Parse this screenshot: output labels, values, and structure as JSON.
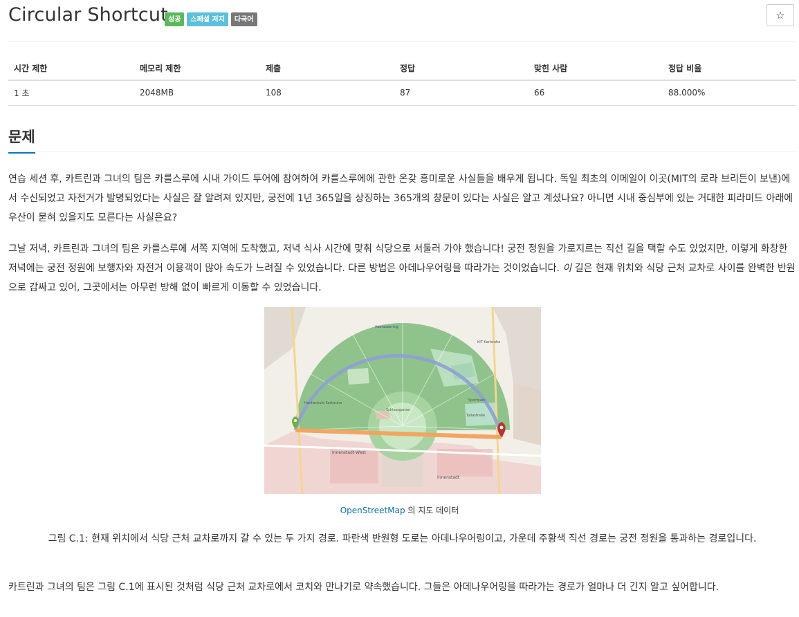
{
  "problem": {
    "title": "Circular Shortcut",
    "badges": [
      "성공",
      "스페셜 저지",
      "다국어"
    ]
  },
  "stats": {
    "headers": [
      "시간 제한",
      "메모리 제한",
      "제출",
      "정답",
      "맞힌 사람",
      "정답 비율"
    ],
    "values": [
      "1 초",
      "2048MB",
      "108",
      "87",
      "66",
      "88.000%"
    ]
  },
  "section": {
    "title": "문제"
  },
  "paragraphs": {
    "p1": "연습 세션 후, 카트린과 그녀의 팀은 카를스루에 시내 가이드 투어에 참여하여 카를스루에에 관한 온갖 흥미로운 사실들을 배우게 됩니다. 독일 최초의 이메일이 이곳(MIT의 로라 브리든이 보낸)에서 수신되었고 자전거가 발명되었다는 사실은 잘 알려져 있지만, 궁전에 1년 365일을 상징하는 365개의 창문이 있다는 사실은 알고 계셨나요? 아니면 시내 중심부에 있는 거대한 피라미드 아래에 우산이 묻혀 있을지도 모른다는 사실은요?",
    "p2_before": "그날 저녁, 카트린과 그녀의 팀은 카를스루에 서쪽 지역에 도착했고, 저녁 식사 시간에 맞춰 식당으로 서둘러 가야 했습니다! 궁전 정원을 가로지르는 직선 길을 택할 수도 있었지만, 이렇게 화창한 저녁에는 궁전 정원에 보행자와 자전거 이용객이 많아 속도가 느려질 수 있었습니다. 다른 방법은 아데나우어링을 따라가는 것이었습니다. ",
    "p2_italic": "이",
    "p2_after": " 길은 현재 위치와 식당 근처 교차로 사이를 완벽한 반원으로 감싸고 있어, 그곳에서는 아무런 방해 없이 빠르게 이동할 수 있었습니다.",
    "p3": "카트린과 그녀의 팀은 그림 C.1에 표시된 것처럼 식당 근처 교차로에서 코치와 만나기로 약속했습니다. 그들은 아데나우어링을 따라가는 경로가 얼마나 더 긴지 알고 싶어합니다."
  },
  "figure": {
    "credit_link": "OpenStreetMap",
    "credit_text": " 의 지도 데이터",
    "caption": "그림 C.1: 현재 위치에서 식당 근처 교차로까지 갈 수 있는 두 가지 경로. 파란색 반원형 도로는 아데나우어링이고, 가운데 주황색 직선 경로는 궁전 정원을 통과하는 경로입니다.",
    "map_labels": {
      "schlossgarten": "Schlossgarten",
      "innenstadt_west": "Innenstadt-West",
      "innenstadt": "Innenstadt",
      "hochschule": "Hochschule Karlsruhe",
      "kit": "KIT Karlsruhe",
      "sportpark": "Sportpark",
      "tulla": "Tullastraße",
      "adenauerring": "Adenauerring"
    },
    "colors": {
      "forest": "#8fc38b",
      "route_blue": "#8f9ed6",
      "route_orange": "#f3a35b",
      "marker_start": "#6bb33e",
      "marker_end": "#c0302f",
      "urban": "#efc1c1"
    }
  },
  "icons": {
    "star": "star-icon"
  }
}
